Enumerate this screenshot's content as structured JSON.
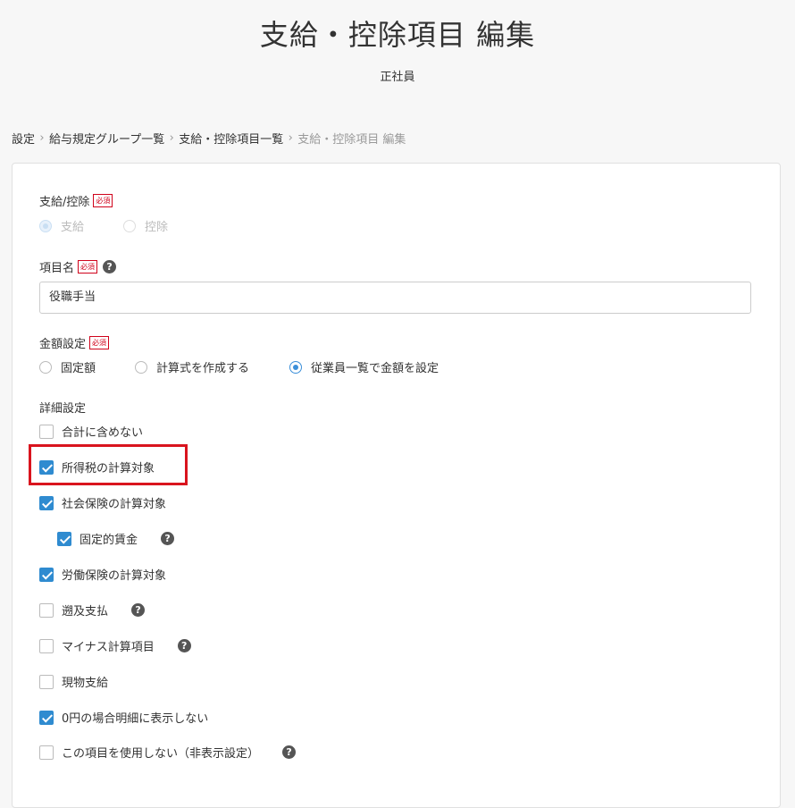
{
  "header": {
    "title": "支給・控除項目 編集",
    "subtitle": "正社員"
  },
  "breadcrumb": {
    "items": [
      "設定",
      "給与規定グループ一覧",
      "支給・控除項目一覧"
    ],
    "current": "支給・控除項目 編集"
  },
  "form": {
    "type": {
      "label": "支給/控除",
      "required": "必須",
      "options": [
        {
          "label": "支給",
          "checked": true,
          "disabled": true
        },
        {
          "label": "控除",
          "checked": false,
          "disabled": true
        }
      ]
    },
    "name": {
      "label": "項目名",
      "required": "必須",
      "help": "?",
      "value": "役職手当"
    },
    "amount": {
      "label": "金額設定",
      "required": "必須",
      "options": [
        {
          "label": "固定額",
          "checked": false
        },
        {
          "label": "計算式を作成する",
          "checked": false
        },
        {
          "label": "従業員一覧で金額を設定",
          "checked": true
        }
      ]
    },
    "details": {
      "label": "詳細設定",
      "items": [
        {
          "label": "合計に含めない",
          "checked": false
        },
        {
          "label": "所得税の計算対象",
          "checked": true
        },
        {
          "label": "社会保険の計算対象",
          "checked": true
        },
        {
          "label": "固定的賃金",
          "checked": true,
          "help": "?"
        },
        {
          "label": "労働保険の計算対象",
          "checked": true
        },
        {
          "label": "遡及支払",
          "checked": false,
          "help": "?"
        },
        {
          "label": "マイナス計算項目",
          "checked": false,
          "help": "?"
        },
        {
          "label": "現物支給",
          "checked": false
        },
        {
          "label": "0円の場合明細に表示しない",
          "checked": true
        },
        {
          "label": "この項目を使用しない（非表示設定）",
          "checked": false,
          "help": "?"
        }
      ]
    }
  },
  "colors": {
    "accent": "#2f8bd0",
    "required": "#d0021b",
    "highlight": "#d9141e"
  }
}
